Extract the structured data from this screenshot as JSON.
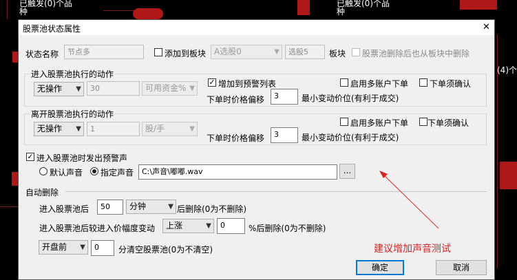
{
  "background": {
    "texts": [
      "已触发(0)个品",
      "种",
      "已触发(0)个品",
      "种",
      "(4)个品"
    ]
  },
  "dialog": {
    "title": "股票池状态属性",
    "close_icon": "✕",
    "status_name_label": "状态名称",
    "status_name_value": "节点多",
    "add_to_block_label": "添加到板块",
    "block_select_value": "A选股0",
    "block_name_value": "选股5",
    "block_label": "板块",
    "remove_from_block_label": "股票池删除后也从板块中删除",
    "enter_group_title": "进入股票池执行的动作",
    "enter_action_value": "无操作",
    "enter_amount_value": "30",
    "enter_unit_value": "可用资金%",
    "add_to_alert_list_label": "增加到预警列表",
    "enter_multi_account_label": "启用多账户下单",
    "enter_order_confirm_label": "下单须确认",
    "enter_price_offset_label": "下单时价格偏移",
    "enter_price_offset_value": "3",
    "enter_min_tick_label": "最小变动价位(有利于成交)",
    "leave_group_title": "离开股票池执行的动作",
    "leave_action_value": "无操作",
    "leave_amount_value": "1",
    "leave_unit_value": "股/手",
    "leave_multi_account_label": "启用多账户下单",
    "leave_order_confirm_label": "下单须确认",
    "leave_price_offset_label": "下单时价格偏移",
    "leave_price_offset_value": "3",
    "leave_min_tick_label": "最小变动价位(有利于成交)",
    "alert_sound_label": "进入股票池时发出预警声",
    "default_sound_label": "默认声音",
    "custom_sound_label": "指定声音",
    "sound_path_value": "C:\\声音\\嘟嘟.wav",
    "browse_label": "...",
    "auto_delete_label": "自动删除",
    "after_enter_label": "进入股票池后",
    "after_enter_value": "50",
    "after_enter_unit": "分钟",
    "after_enter_suffix": "后删除(0为不删除)",
    "price_change_label": "进入股票池后较进入价幅度变动",
    "price_change_direction": "上涨",
    "price_change_value": "0",
    "price_change_suffix": "%后删除(0为不删除)",
    "clear_when_value": "开盘前",
    "clear_minutes_value": "0",
    "clear_suffix": "分清空股票池(0为不清空)",
    "ok_label": "确定",
    "cancel_label": "取消"
  },
  "annotation": {
    "text": "建议增加声音测试",
    "color": "#e02020"
  }
}
